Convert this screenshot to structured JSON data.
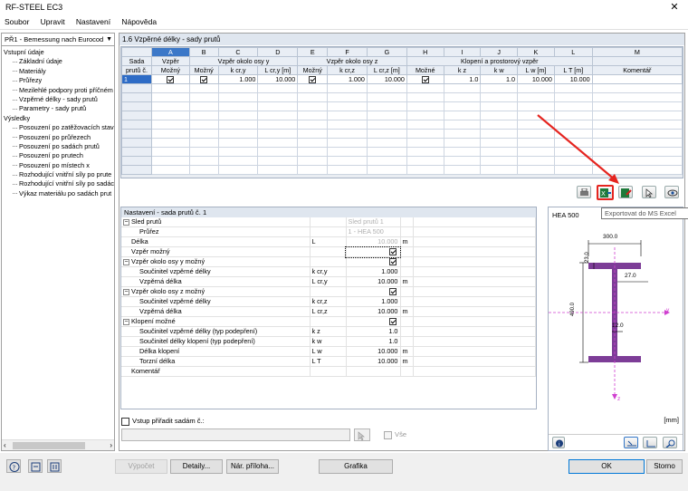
{
  "window": {
    "title": "RF-STEEL EC3",
    "close": "✕"
  },
  "menu": [
    "Soubor",
    "Upravit",
    "Nastavení",
    "Nápověda"
  ],
  "sidebar": {
    "module": "PŘ1 - Bemessung nach Eurocod",
    "tree": [
      {
        "label": "Vstupní údaje",
        "level": 0
      },
      {
        "label": "Základní údaje",
        "level": 1
      },
      {
        "label": "Materiály",
        "level": 1
      },
      {
        "label": "Průřezy",
        "level": 1
      },
      {
        "label": "Mezilehlé podpory proti příčném",
        "level": 1
      },
      {
        "label": "Vzpěrné délky - sady prutů",
        "level": 1
      },
      {
        "label": "Parametry - sady prutů",
        "level": 1
      },
      {
        "label": "Výsledky",
        "level": 0
      },
      {
        "label": "Posouzení po zatěžovacích stav",
        "level": 1
      },
      {
        "label": "Posouzení po průřezech",
        "level": 1
      },
      {
        "label": "Posouzení po sadách prutů",
        "level": 1
      },
      {
        "label": "Posouzení po prutech",
        "level": 1
      },
      {
        "label": "Posouzení po místech x",
        "level": 1
      },
      {
        "label": "Rozhodující vnitřní síly po prute",
        "level": 1
      },
      {
        "label": "Rozhodující vnitřní síly po sadác",
        "level": 1
      },
      {
        "label": "Výkaz materiálu po sadách prut",
        "level": 1
      }
    ]
  },
  "table": {
    "title": "1.6 Vzpěrné délky - sady prutů",
    "letters": [
      "A",
      "B",
      "C",
      "D",
      "E",
      "F",
      "G",
      "H",
      "I",
      "J",
      "K",
      "L",
      "M"
    ],
    "group_headers": {
      "sada": "Sada",
      "sada2": "prutů č.",
      "vzper": "Vzpěr",
      "vzper_y": "Vzpěr okolo osy y",
      "vzper_z": "Vzpěr okolo osy z",
      "klopeni": "Klopení a prostorový vzpěr"
    },
    "col_headers": [
      "Možný",
      "Možný",
      "k cr,y",
      "L cr,y [m]",
      "Možný",
      "k cr,z",
      "L cr,z [m]",
      "Možné",
      "k z",
      "k w",
      "L w [m]",
      "L T [m]",
      "Komentář"
    ],
    "row": {
      "no": "1",
      "kcry": "1.000",
      "lcry": "10.000",
      "kcrz": "1.000",
      "lcrz": "10.000",
      "kz": "1.0",
      "kw": "1.0",
      "lw": "10.000",
      "lt": "10.000",
      "comment": ""
    }
  },
  "tooltip": "Exportovat do MS Excel",
  "settings": {
    "title": "Nastavení - sada prutů č. 1",
    "rows": [
      {
        "label": "Sled prutů",
        "sym": "",
        "val": "Sled prutů 1",
        "unit": "",
        "indent": 0,
        "exp": true,
        "gray": true
      },
      {
        "label": "Průřez",
        "sym": "",
        "val": "1 - HEA 500",
        "unit": "",
        "indent": 2,
        "gray": true
      },
      {
        "label": "Délka",
        "sym": "L",
        "val": "10.000",
        "unit": "m",
        "indent": 1,
        "gray": true
      },
      {
        "label": "Vzpěr možný",
        "sym": "",
        "val": "check",
        "unit": "",
        "indent": 1
      },
      {
        "label": "Vzpěr okolo osy y možný",
        "sym": "",
        "val": "check",
        "unit": "",
        "indent": 0,
        "exp": true
      },
      {
        "label": "Součinitel vzpěrné délky",
        "sym": "k cr,y",
        "val": "1.000",
        "unit": "",
        "indent": 2
      },
      {
        "label": "Vzpěrná délka",
        "sym": "L cr,y",
        "val": "10.000",
        "unit": "m",
        "indent": 2
      },
      {
        "label": "Vzpěr okolo osy z možný",
        "sym": "",
        "val": "check",
        "unit": "",
        "indent": 0,
        "exp": true
      },
      {
        "label": "Součinitel vzpěrné délky",
        "sym": "k cr,z",
        "val": "1.000",
        "unit": "",
        "indent": 2
      },
      {
        "label": "Vzpěrná délka",
        "sym": "L cr,z",
        "val": "10.000",
        "unit": "m",
        "indent": 2
      },
      {
        "label": "Klopení možné",
        "sym": "",
        "val": "check",
        "unit": "",
        "indent": 0,
        "exp": true
      },
      {
        "label": "Součinitel vzpěrné délky (typ podepření)",
        "sym": "k z",
        "val": "1.0",
        "unit": "",
        "indent": 2
      },
      {
        "label": "Součinitel délky klopení (typ podepření)",
        "sym": "k w",
        "val": "1.0",
        "unit": "",
        "indent": 2
      },
      {
        "label": "Délka klopení",
        "sym": "L w",
        "val": "10.000",
        "unit": "m",
        "indent": 2
      },
      {
        "label": "Torzní délka",
        "sym": "L T",
        "val": "10.000",
        "unit": "m",
        "indent": 2
      },
      {
        "label": "Komentář",
        "sym": "",
        "val": "",
        "unit": "",
        "indent": 1
      }
    ],
    "assign_label": "Vstup přiřadit sadám č.:",
    "all_label": "Vše"
  },
  "preview": {
    "section": "HEA 500",
    "unit": "[mm]",
    "b": "300.0",
    "tf": "23.0",
    "h": "490.0",
    "tw": "12.0",
    "r": "27.0",
    "axis_y": "y",
    "axis_z": "z"
  },
  "buttons": {
    "calc": "Výpočet",
    "details": "Detaily...",
    "nat": "Nár. příloha...",
    "graphics": "Grafika",
    "ok": "OK",
    "cancel": "Storno"
  }
}
